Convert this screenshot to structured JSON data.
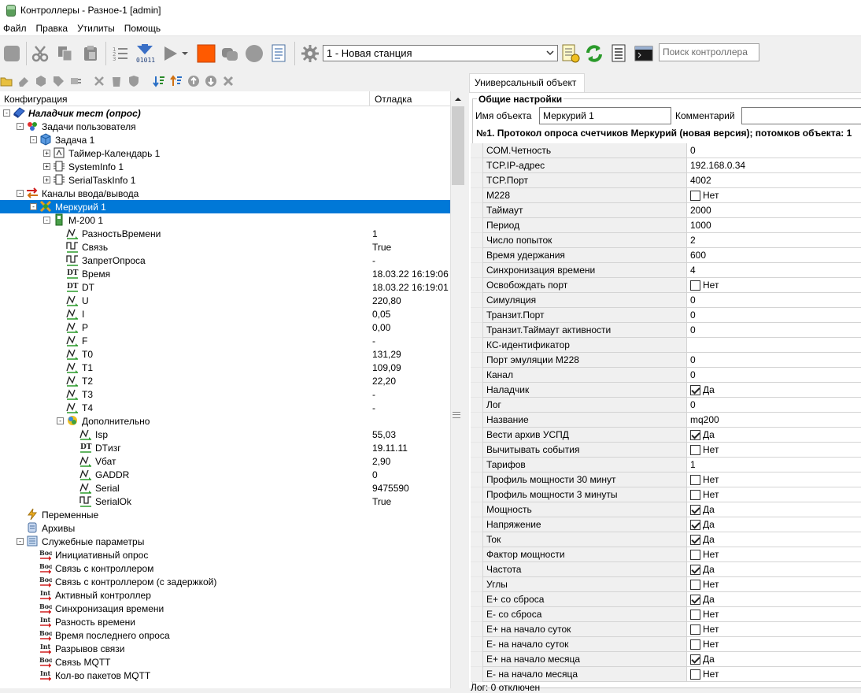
{
  "window": {
    "title": "Контроллеры - Разное-1 [admin]"
  },
  "menu": [
    "Файл",
    "Правка",
    "Утилиты",
    "Помощь"
  ],
  "toolbar": {
    "station_value": "1 - Новая станция",
    "search_placeholder": "Поиск контроллера",
    "stop_color": "#ff5a00"
  },
  "tree": {
    "header": {
      "config": "Конфигурация",
      "debug": "Отладка"
    },
    "rows": [
      {
        "level": 0,
        "exp": "-",
        "icon": "project-icon",
        "label": "Наладчик тест (опрос)",
        "bold": true
      },
      {
        "level": 1,
        "exp": "-",
        "icon": "user-tasks-icon",
        "label": "Задачи пользователя"
      },
      {
        "level": 2,
        "exp": "-",
        "icon": "cube-icon",
        "label": "Задача 1"
      },
      {
        "level": 3,
        "exp": "+",
        "icon": "timer-icon",
        "label": "Таймер-Календарь 1"
      },
      {
        "level": 3,
        "exp": "+",
        "icon": "module-icon",
        "label": "SystemInfo 1"
      },
      {
        "level": 3,
        "exp": "+",
        "icon": "module-icon",
        "label": "SerialTaskInfo 1"
      },
      {
        "level": 1,
        "exp": "-",
        "icon": "io-channels-icon",
        "label": "Каналы ввода/вывода"
      },
      {
        "level": 2,
        "exp": "-",
        "icon": "mercury-icon",
        "label": "Меркурий 1",
        "selected": true
      },
      {
        "level": 3,
        "exp": "-",
        "icon": "meter-icon",
        "label": "М-200 1"
      },
      {
        "level": 4,
        "icon": "analog-icon",
        "label": "РазностьВремени",
        "value": "1"
      },
      {
        "level": 4,
        "icon": "discrete-icon",
        "label": "Связь",
        "value": "True"
      },
      {
        "level": 4,
        "icon": "discrete-icon",
        "label": "ЗапретОпроса",
        "value": "-"
      },
      {
        "level": 4,
        "icon": "datetime-icon",
        "label": "Время",
        "value": "18.03.22 16:19:06"
      },
      {
        "level": 4,
        "icon": "datetime-icon",
        "label": "DT",
        "value": "18.03.22 16:19:01"
      },
      {
        "level": 4,
        "icon": "analog-icon",
        "label": "U",
        "value": "220,80"
      },
      {
        "level": 4,
        "icon": "analog-icon",
        "label": "I",
        "value": "0,05"
      },
      {
        "level": 4,
        "icon": "analog-icon",
        "label": "P",
        "value": "0,00"
      },
      {
        "level": 4,
        "icon": "analog-icon",
        "label": "F",
        "value": "-"
      },
      {
        "level": 4,
        "icon": "analog-icon",
        "label": "T0",
        "value": "131,29"
      },
      {
        "level": 4,
        "icon": "analog-icon",
        "label": "T1",
        "value": "109,09"
      },
      {
        "level": 4,
        "icon": "analog-icon",
        "label": "T2",
        "value": "22,20"
      },
      {
        "level": 4,
        "icon": "analog-icon",
        "label": "T3",
        "value": "-"
      },
      {
        "level": 4,
        "icon": "analog-icon",
        "label": "T4",
        "value": "-"
      },
      {
        "level": 4,
        "exp": "-",
        "icon": "additional-icon",
        "label": "Дополнительно"
      },
      {
        "level": 5,
        "icon": "analog-icon",
        "label": "Isp",
        "value": "55,03"
      },
      {
        "level": 5,
        "icon": "datetime-icon",
        "label": "DTизг",
        "value": "19.11.11"
      },
      {
        "level": 5,
        "icon": "analog-icon",
        "label": "Vбат",
        "value": "2,90"
      },
      {
        "level": 5,
        "icon": "analog-icon",
        "label": "GADDR",
        "value": "0"
      },
      {
        "level": 5,
        "icon": "analog-icon",
        "label": "Serial",
        "value": "9475590"
      },
      {
        "level": 5,
        "icon": "discrete-icon",
        "label": "SerialOk",
        "value": "True"
      },
      {
        "level": 1,
        "icon": "variables-icon",
        "label": "Переменные"
      },
      {
        "level": 1,
        "icon": "archives-icon",
        "label": "Архивы"
      },
      {
        "level": 1,
        "exp": "-",
        "icon": "service-params-icon",
        "label": "Служебные параметры"
      },
      {
        "level": 2,
        "icon": "bool-icon",
        "label": "Инициативный опрос"
      },
      {
        "level": 2,
        "icon": "bool-icon",
        "label": "Связь с контроллером"
      },
      {
        "level": 2,
        "icon": "bool-icon",
        "label": "Связь с контроллером (с задержкой)"
      },
      {
        "level": 2,
        "icon": "int-icon",
        "label": "Активный контроллер"
      },
      {
        "level": 2,
        "icon": "bool-icon",
        "label": "Синхронизация времени"
      },
      {
        "level": 2,
        "icon": "int-icon",
        "label": "Разность времени"
      },
      {
        "level": 2,
        "icon": "bool-icon",
        "label": "Время последнего опроса"
      },
      {
        "level": 2,
        "icon": "int-icon",
        "label": "Разрывов связи"
      },
      {
        "level": 2,
        "icon": "bool-icon",
        "label": "Связь MQTT"
      },
      {
        "level": 2,
        "icon": "int-icon",
        "label": "Кол-во пакетов MQTT"
      }
    ]
  },
  "right": {
    "tab": "Универсальный объект",
    "group_title": "Общие настройки",
    "object_name_label": "Имя объекта",
    "object_name_value": "Меркурий 1",
    "comment_label": "Комментарий",
    "comment_value": "",
    "protocol": "№1. Протокол опроса счетчиков Меркурий (новая версия); потомков объекта: 1",
    "properties": [
      {
        "name": "COM.Четность",
        "value": "0"
      },
      {
        "name": "TCP.IP-адрес",
        "value": "192.168.0.34"
      },
      {
        "name": "TCP.Порт",
        "value": "4002"
      },
      {
        "name": "M228",
        "value": "Нет",
        "checkbox": false
      },
      {
        "name": "Таймаут",
        "value": "2000"
      },
      {
        "name": "Период",
        "value": "1000"
      },
      {
        "name": "Число попыток",
        "value": "2"
      },
      {
        "name": "Время удержания",
        "value": "600"
      },
      {
        "name": "Синхронизация времени",
        "value": "4"
      },
      {
        "name": "Освобождать порт",
        "value": "Нет",
        "checkbox": false
      },
      {
        "name": "Симуляция",
        "value": "0"
      },
      {
        "name": "Транзит.Порт",
        "value": "0"
      },
      {
        "name": "Транзит.Таймаут активности",
        "value": "0"
      },
      {
        "name": "КС-идентификатор",
        "value": ""
      },
      {
        "name": "Порт эмуляции M228",
        "value": "0"
      },
      {
        "name": "Канал",
        "value": "0"
      },
      {
        "name": "Наладчик",
        "value": "Да",
        "checkbox": true
      },
      {
        "name": "Лог",
        "value": "0"
      },
      {
        "name": "Название",
        "value": "mq200"
      },
      {
        "name": "Вести архив УСПД",
        "value": "Да",
        "checkbox": true
      },
      {
        "name": "Вычитывать события",
        "value": "Нет",
        "checkbox": false
      },
      {
        "name": "Тарифов",
        "value": "1"
      },
      {
        "name": "Профиль мощности 30 минут",
        "value": "Нет",
        "checkbox": false
      },
      {
        "name": "Профиль мощности 3 минуты",
        "value": "Нет",
        "checkbox": false
      },
      {
        "name": "Мощность",
        "value": "Да",
        "checkbox": true
      },
      {
        "name": "Напряжение",
        "value": "Да",
        "checkbox": true
      },
      {
        "name": "Ток",
        "value": "Да",
        "checkbox": true
      },
      {
        "name": "Фактор мощности",
        "value": "Нет",
        "checkbox": false
      },
      {
        "name": "Частота",
        "value": "Да",
        "checkbox": true
      },
      {
        "name": "Углы",
        "value": "Нет",
        "checkbox": false
      },
      {
        "name": "E+ со сброса",
        "value": "Да",
        "checkbox": true
      },
      {
        "name": "E- со сброса",
        "value": "Нет",
        "checkbox": false
      },
      {
        "name": "E+ на начало суток",
        "value": "Нет",
        "checkbox": false
      },
      {
        "name": "E- на начало суток",
        "value": "Нет",
        "checkbox": false
      },
      {
        "name": "E+ на начало месяца",
        "value": "Да",
        "checkbox": true
      },
      {
        "name": "E- на начало месяца",
        "value": "Нет",
        "checkbox": false
      }
    ],
    "status": "Лог: 0 отключен"
  }
}
